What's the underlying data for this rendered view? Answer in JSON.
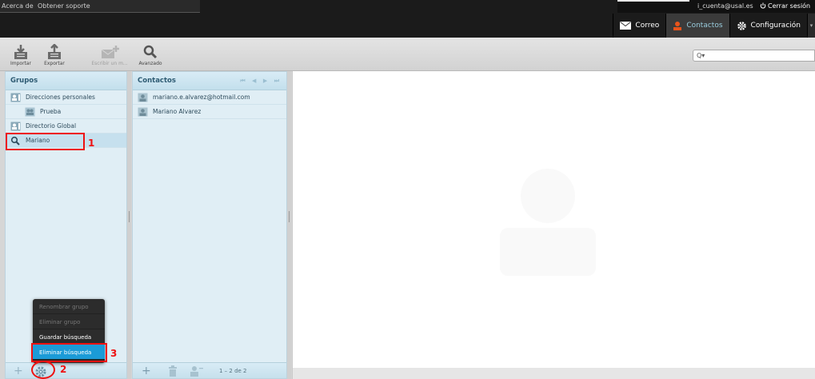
{
  "topbar": {
    "left_links": [
      "Acerca de",
      "Obtener soporte"
    ],
    "user": "i_cuenta@usal.es",
    "logout": "Cerrar sesión"
  },
  "nav": {
    "items": [
      {
        "label": "Correo",
        "icon": "mail-icon"
      },
      {
        "label": "Contactos",
        "icon": "contacts-icon",
        "active": true
      },
      {
        "label": "Configuración",
        "icon": "gear-icon"
      }
    ]
  },
  "toolbar": {
    "import_label": "Importar",
    "export_label": "Exportar",
    "write_label": "Escribir un m...",
    "advanced_label": "Avanzado",
    "search_icon_label": "Q▾"
  },
  "groups": {
    "title": "Grupos",
    "items": [
      {
        "label": "Direcciones personales"
      },
      {
        "label": "Prueba"
      },
      {
        "label": "Directorio Global"
      },
      {
        "label": "Mariano"
      }
    ]
  },
  "contacts": {
    "title": "Contactos",
    "pager": "⏮ ◀ ▶ ⏭",
    "items": [
      "mariano.e.alvarez@hotmail.com",
      "Mariano Alvarez"
    ],
    "count": "1 – 2 de 2"
  },
  "popup_menu": {
    "items": [
      {
        "label": "Renombrar grupo",
        "enabled": false
      },
      {
        "label": "Eliminar grupo",
        "enabled": false
      },
      {
        "label": "Guardar búsqueda",
        "enabled": true
      },
      {
        "label": "Eliminar búsqueda",
        "enabled": true,
        "highlight": true
      }
    ]
  },
  "annotations": [
    "1",
    "2",
    "3"
  ],
  "colors": {
    "accent": "#1b9bd7",
    "annotation": "#e11111",
    "panel_bg": "#e0eef5"
  }
}
